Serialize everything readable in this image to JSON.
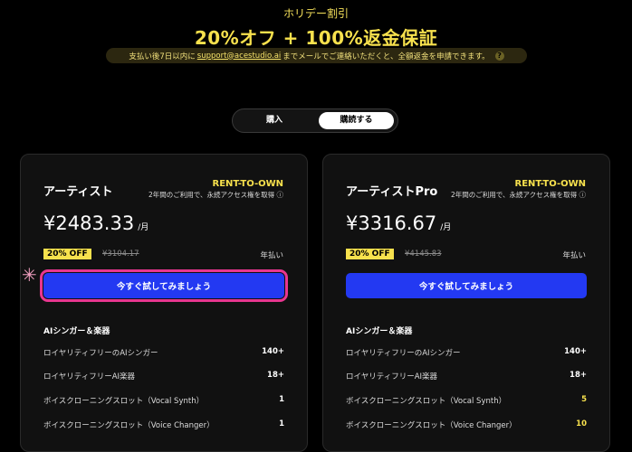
{
  "promo": {
    "kicker": "ホリデー割引",
    "headline": "20%オフ + 100%返金保証",
    "notice_prefix": "支払い後7日以内に",
    "notice_email": "support@acestudio.ai",
    "notice_suffix": "までメールでご連絡いただくと、全額返金を申請できます。",
    "help_icon": "?"
  },
  "toggle": {
    "option_buy": "購入",
    "option_subscribe": "購読する",
    "selected": "購読する"
  },
  "plans": [
    {
      "name": "アーティスト",
      "rto_title": "RENT-TO-OWN",
      "rto_sub": "2年間のご利用で、永続アクセス権を取得 ⓘ",
      "price": "¥2483.33",
      "per": "/月",
      "discount": "20% OFF",
      "original_price": "¥3104.17",
      "billing": "年払い",
      "cta": "今すぐ試してみましょう",
      "section": "AIシンガー＆楽器",
      "features": [
        {
          "label": "ロイヤリティフリーのAIシンガー",
          "value": "140+"
        },
        {
          "label": "ロイヤリティフリーAI楽器",
          "value": "18+"
        },
        {
          "label": "ボイスクローニングスロット（Vocal Synth）",
          "value": "1"
        },
        {
          "label": "ボイスクローニングスロット（Voice Changer）",
          "value": "1"
        }
      ]
    },
    {
      "name": "アーティストPro",
      "rto_title": "RENT-TO-OWN",
      "rto_sub": "2年間のご利用で、永続アクセス権を取得 ⓘ",
      "price": "¥3316.67",
      "per": "/月",
      "discount": "20% OFF",
      "original_price": "¥4145.83",
      "billing": "年払い",
      "cta": "今すぐ試してみましょう",
      "section": "AIシンガー＆楽器",
      "features": [
        {
          "label": "ロイヤリティフリーのAIシンガー",
          "value": "140+"
        },
        {
          "label": "ロイヤリティフリーAI楽器",
          "value": "18+"
        },
        {
          "label": "ボイスクローニングスロット（Vocal Synth）",
          "value": "5"
        },
        {
          "label": "ボイスクローニングスロット（Voice Changer）",
          "value": "10"
        }
      ]
    }
  ],
  "colors": {
    "accent_yellow": "#f7e14d",
    "cta_blue": "#2339f2",
    "highlight_pink": "#e8368f"
  }
}
